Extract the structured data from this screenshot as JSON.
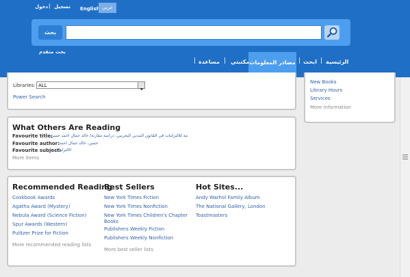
{
  "header": {
    "login": "دخول",
    "separator": "|",
    "register": "تسجيل",
    "lang_en": "English",
    "lang_ar": "عربي",
    "search_button": "بحث",
    "search_value": "",
    "advanced_search": "بحث متقدم",
    "nav": {
      "home": "الرئيسية",
      "search": "ابحث",
      "sources": "مصادر المعلومات",
      "my_library": "مكتبتي",
      "help": "مساعدة"
    }
  },
  "search_options": {
    "libraries_label": "Libraries:",
    "libraries_value": "ALL",
    "power_search": "Power Search"
  },
  "sidebar": {
    "items": [
      {
        "label": "New Books"
      },
      {
        "label": "Library Hours"
      },
      {
        "label": "Services"
      }
    ],
    "more": "More information"
  },
  "what_others": {
    "heading": "What Others Are Reading",
    "title_label": "Favourite title:",
    "title_value": "النظرية العامة للالتزامات في القانون المدني البحريني: دراسة مقارنة/ خالد جمال احمد حسن",
    "author_label": "Favourite author:",
    "author_value": "حسن، خالد جمال احمد",
    "subject_label": "Favourite subject:",
    "subject_value": "الالتزامات",
    "more": "More items"
  },
  "recommended": {
    "heading": "Recommended Reading",
    "items": [
      {
        "label": "Cookbook Awards"
      },
      {
        "label": "Agatha Award (Mystery)"
      },
      {
        "label": "Nebula Award (Science Fiction)"
      },
      {
        "label": "Spur Awards (Western)"
      },
      {
        "label": "Pulitzer Prize for Fiction"
      }
    ],
    "more": "More recommended reading lists"
  },
  "best_sellers": {
    "heading": "Best Sellers",
    "items": [
      {
        "label": "New York Times Fiction"
      },
      {
        "label": "New York Times Nonfiction"
      },
      {
        "label": "New York Times Children's Chapter Books"
      },
      {
        "label": "Publishers Weekly Fiction"
      },
      {
        "label": "Publishers Weekly Nonfiction"
      }
    ],
    "more": "More best seller lists"
  },
  "hot_sites": {
    "heading": "Hot Sites...",
    "items": [
      {
        "label": "Andy Warhol Family Album"
      },
      {
        "label": "The National Gallery, London"
      },
      {
        "label": "Toastmasters"
      }
    ]
  },
  "colors": {
    "header": "#1f6fc6",
    "search_panel": "#4d9eee",
    "link": "#2f5ea8"
  },
  "icons": [
    "magnifier-icon",
    "dropdown-arrow-icon",
    "scrollbar-grip-icon"
  ]
}
